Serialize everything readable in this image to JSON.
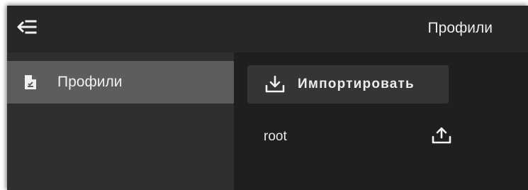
{
  "appbar": {
    "back_icon": "menu-open-icon",
    "title": "Профили"
  },
  "sidebar": {
    "items": [
      {
        "label": "Профили",
        "icon": "file-document-icon",
        "selected": true
      }
    ]
  },
  "main": {
    "import_button": {
      "label": "Импортировать",
      "icon": "download-icon"
    },
    "profiles": [
      {
        "name": "root",
        "action_icon": "upload-icon"
      }
    ]
  },
  "colors": {
    "appbar_bg": "#272727",
    "sidebar_bg": "#2f2f2f",
    "selected_item_bg": "#5d5d5d",
    "content_bg": "#1f1f1f",
    "button_bg": "#353535",
    "text": "#ececec"
  }
}
